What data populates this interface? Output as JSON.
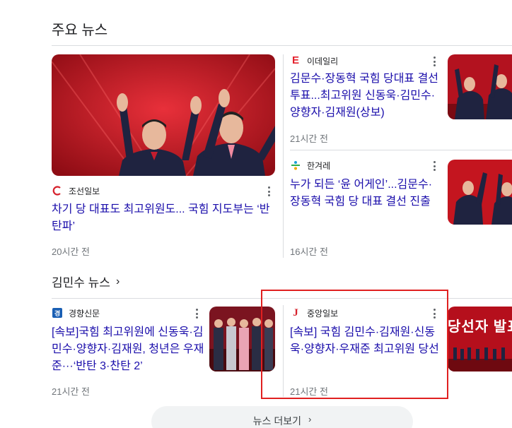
{
  "top_news": {
    "title": "주요 뉴스",
    "main_article": {
      "source": "조선일보",
      "headline": "차기 당 대표도 최고위원도... 국힘 지도부는 ‘반탄파’",
      "time": "20시간 전"
    },
    "side_articles": [
      {
        "source": "이데일리",
        "headline": "김문수·장동혁 국힘 당대표 결선투표...최고위원 신동욱·김민수·양향자·김재원(상보)",
        "time": "21시간 전"
      },
      {
        "source": "한겨레",
        "headline": "누가 되든 ‘윤 어게인’...김문수·장동혁 국힘 당 대표 결선 진출",
        "time": "16시간 전"
      }
    ]
  },
  "kim_news": {
    "title": "김민수 뉴스",
    "articles": [
      {
        "source": "경향신문",
        "headline": "[속보]국힘 최고위원에 신동욱·김민수·양향자·김재원, 청년은 우재준···‘반탄 3·찬탄 2’",
        "time": "21시간 전"
      },
      {
        "source": "중앙일보",
        "headline": "[속보] 국힘 김민수·김재원·신동욱·양향자·우재준 최고위원 당선",
        "time": "21시간 전"
      }
    ],
    "banner_text": "당선자 발표"
  },
  "more_news_button": "뉴스 더보기",
  "colors": {
    "link": "#1a0dab",
    "highlight": "#e02020",
    "stage_red": "#c8102e"
  }
}
